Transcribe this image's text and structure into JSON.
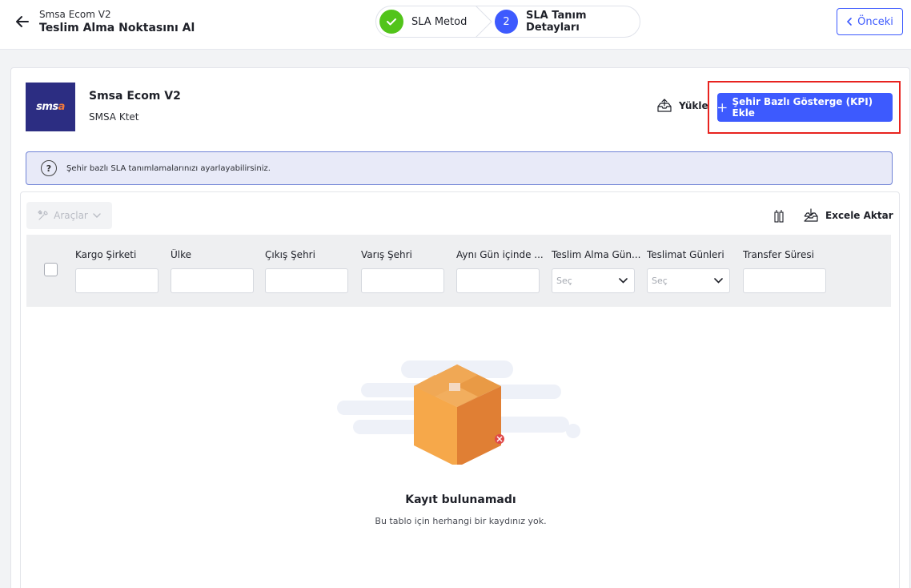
{
  "header": {
    "subtitle": "Smsa Ecom V2",
    "title": "Teslim Alma Noktasını Al",
    "prev_label": "Önceki"
  },
  "stepper": {
    "steps": [
      {
        "number": "1",
        "label": "SLA Metod",
        "status": "done"
      },
      {
        "number": "2",
        "label": "SLA Tanım Detayları",
        "status": "active"
      }
    ]
  },
  "company": {
    "logo_text_main": "sms",
    "logo_text_accent": "a",
    "name": "Smsa Ecom V2",
    "sub": "SMSA Ktet"
  },
  "actions": {
    "upload_label": "Yükle",
    "add_kpi_label": "Şehir Bazlı Gösterge (KPI) Ekle"
  },
  "info": {
    "icon": "?",
    "text": "Şehir bazlı SLA tanımlamalarınızı ayarlayabilirsiniz."
  },
  "grid": {
    "tools_label": "Araçlar",
    "excel_label": "Excele Aktar",
    "columns": [
      {
        "label": "Kargo Şirketi",
        "filter": "input"
      },
      {
        "label": "Ülke",
        "filter": "input"
      },
      {
        "label": "Çıkış Şehri",
        "filter": "input"
      },
      {
        "label": "Varış Şehri",
        "filter": "input"
      },
      {
        "label": "Aynı Gün içinde ...",
        "filter": "input"
      },
      {
        "label": "Teslim Alma Gün...",
        "filter": "select",
        "placeholder": "Seç"
      },
      {
        "label": "Teslimat Günleri",
        "filter": "select",
        "placeholder": "Seç"
      },
      {
        "label": "Transfer Süresi",
        "filter": "input"
      }
    ],
    "empty_title": "Kayıt bulunamadı",
    "empty_sub": "Bu tablo için herhangi bir kaydınız yok."
  },
  "colors": {
    "primary": "#3d5afe",
    "success": "#52c41a",
    "highlight": "#e8231f",
    "logo_bg": "#2c2d82",
    "box": "#f6a84a"
  }
}
